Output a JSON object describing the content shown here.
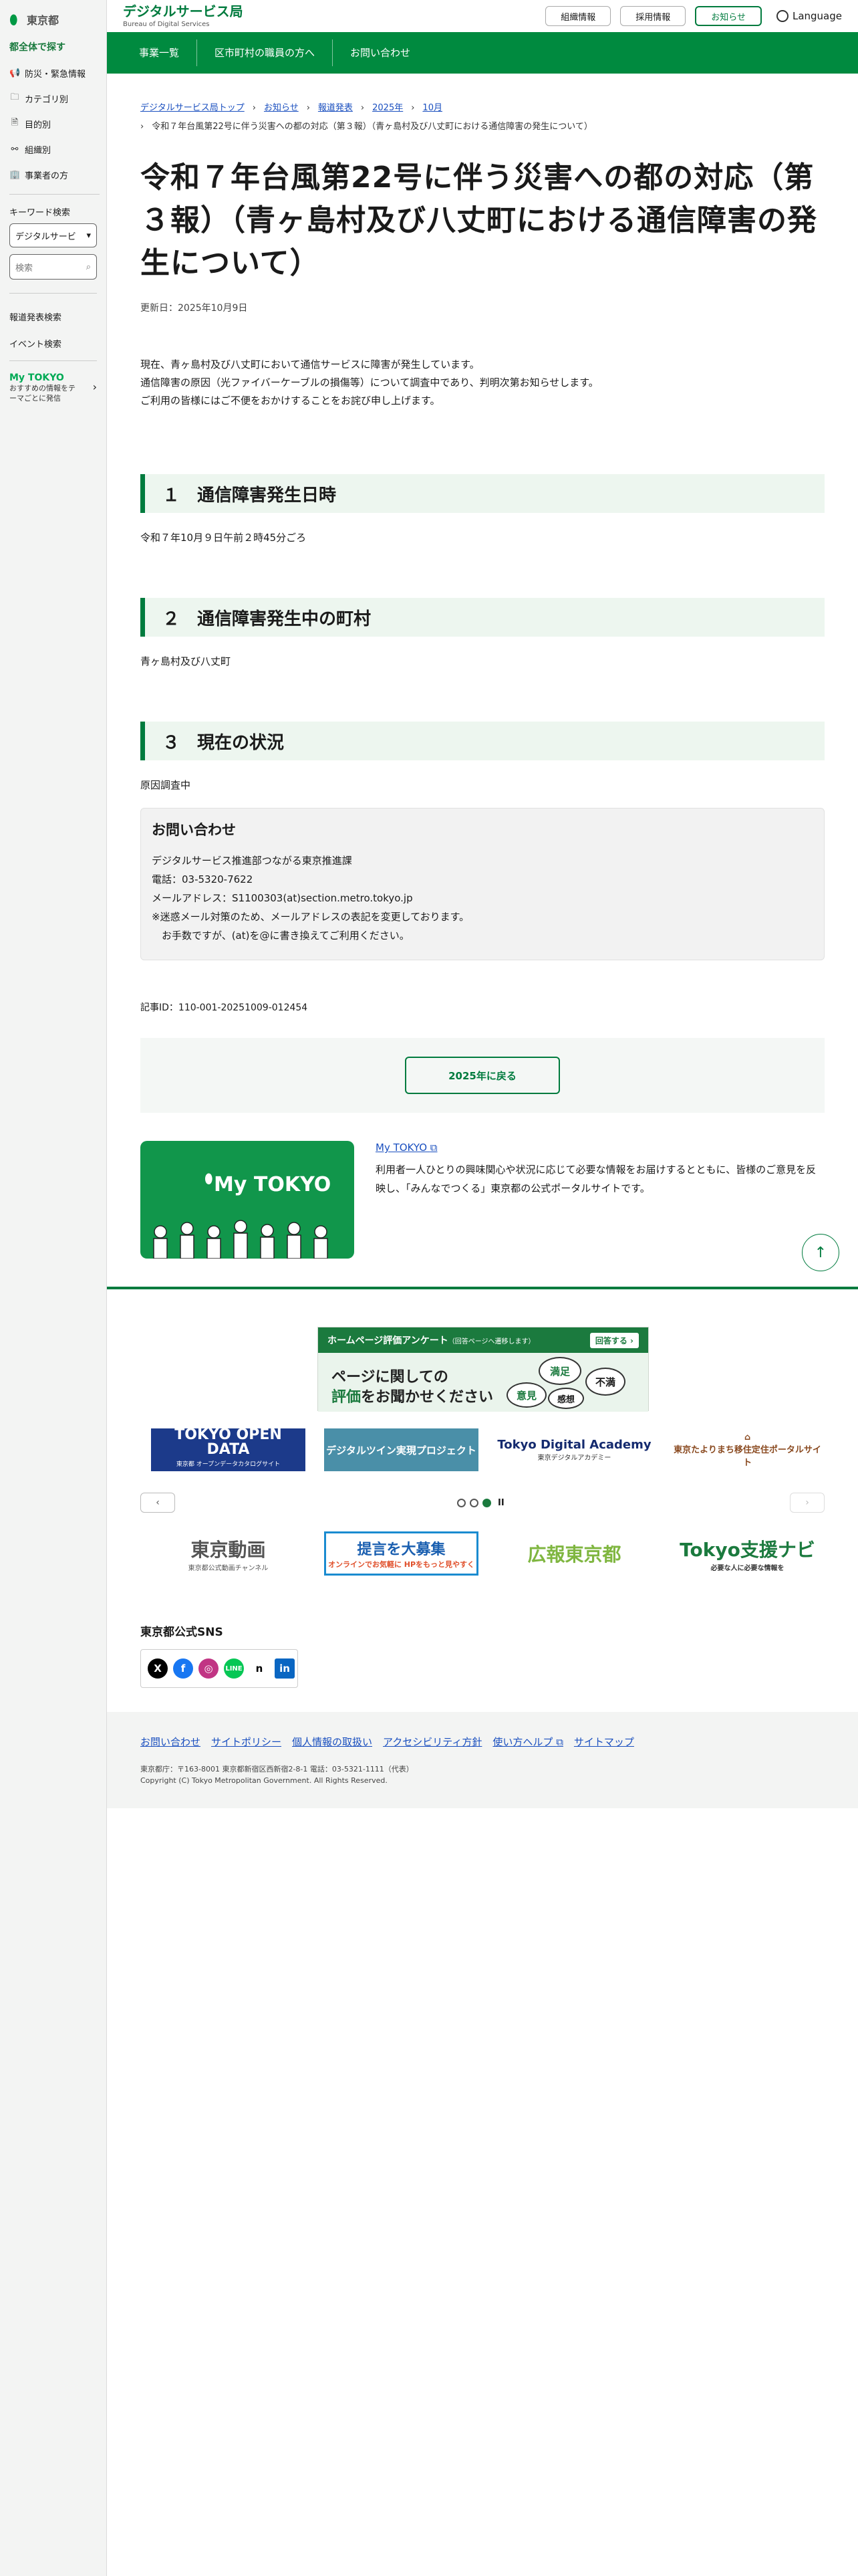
{
  "sidebar": {
    "logo_text": "東京都",
    "heading": "都全体で探す",
    "items": [
      {
        "icon": "megaphone-icon",
        "glyph": "📢",
        "label": "防災・緊急情報"
      },
      {
        "icon": "folder-icon",
        "glyph": "🗀",
        "label": "カテゴリ別"
      },
      {
        "icon": "document-icon",
        "glyph": "🗎",
        "label": "目的別"
      },
      {
        "icon": "org-icon",
        "glyph": "⚯",
        "label": "組織別"
      },
      {
        "icon": "building-icon",
        "glyph": "🏢",
        "label": "事業者の方"
      }
    ],
    "keyword_label": "キーワード検索",
    "keyword_select": "デジタルサービ",
    "search_placeholder": "検索",
    "links": [
      "報道発表検索",
      "イベント検索"
    ],
    "mytokyo_title": "My TOKYO",
    "mytokyo_desc": "おすすめの情報をテーマごとに発信"
  },
  "header": {
    "dept_name": "デジタルサービス局",
    "dept_en": "Bureau of Digital Services",
    "buttons": [
      "組織情報",
      "採用情報",
      "お知らせ"
    ],
    "language": "Language"
  },
  "nav": [
    "事業一覧",
    "区市町村の職員の方へ",
    "お問い合わせ"
  ],
  "breadcrumb": {
    "items": [
      "デジタルサービス局トップ",
      "お知らせ",
      "報道発表",
      "2025年",
      "10月"
    ],
    "current": "令和７年台風第22号に伴う災害への都の対応（第３報）（青ヶ島村及び八丈町における通信障害の発生について）"
  },
  "article": {
    "title": "令和７年台風第22号に伴う災害への都の対応（第３報）（青ヶ島村及び八丈町における通信障害の発生について）",
    "updated": "更新日：2025年10月9日",
    "lead": [
      "現在、青ヶ島村及び八丈町において通信サービスに障害が発生しています。",
      "通信障害の原因（光ファイバーケーブルの損傷等）について調査中であり、判明次第お知らせします。",
      "ご利用の皆様にはご不便をおかけすることをお詫び申し上げます。"
    ],
    "sections": [
      {
        "heading": "１　通信障害発生日時",
        "body": "令和７年10月９日午前２時45分ごろ"
      },
      {
        "heading": "２　通信障害発生中の町村",
        "body": "青ヶ島村及び八丈町"
      },
      {
        "heading": "３　現在の状況",
        "body": "原因調査中"
      }
    ],
    "contact": {
      "title": "お問い合わせ",
      "lines": [
        "デジタルサービス推進部つながる東京推進課",
        "電話：03-5320-7622",
        "メールアドレス：S1100303(at)section.metro.tokyo.jp",
        "※迷惑メール対策のため、メールアドレスの表記を変更しております。",
        "　お手数ですが、(at)を@に書き換えてご利用ください。"
      ]
    },
    "article_id": "記事ID：110-001-20251009-012454",
    "back_label": "2025年に戻る"
  },
  "promo": {
    "image_text": "My TOKYO",
    "link": "My TOKYO",
    "desc": "利用者一人ひとりの興味関心や状況に応じて必要な情報をお届けするとともに、皆様のご意見を反映し、「みんなでつくる」東京都の公式ポータルサイトです。"
  },
  "survey": {
    "bar_title": "ホームページ評価アンケート",
    "bar_note": "（回答ページへ遷移します）",
    "answer": "回答する ›",
    "line1": "ページに関しての",
    "line2_em": "評価",
    "line2_rest": "をお聞かせください",
    "bubbles": [
      "満足",
      "不満",
      "意見",
      "感想"
    ]
  },
  "banners": [
    {
      "title": "TOKYO OPEN DATA",
      "sub": "東京都 オープンデータカタログサイト"
    },
    {
      "title": "デジタルツイン実現プロジェクト",
      "sub": ""
    },
    {
      "title": "Tokyo Digital Academy",
      "sub": "東京デジタルアカデミー"
    },
    {
      "title": "東京たよりまち",
      "sub": "東京たよりまち移住定住ポータルサイト"
    }
  ],
  "carousel": {
    "prev": "‹",
    "next": "›",
    "pause": "II"
  },
  "banners2": [
    {
      "title": "東京動画",
      "sub": "東京都公式動画チャンネル"
    },
    {
      "title": "提言を大募集",
      "sub": "オンラインでお気軽に HPをもっと見やすく"
    },
    {
      "title": "広報東京都",
      "sub": ""
    },
    {
      "title": "Tokyo支援ナビ",
      "sub": "必要な人に必要な情報を"
    }
  ],
  "sns": {
    "title": "東京都公式SNS",
    "items": [
      "X",
      "f",
      "◎",
      "LINE",
      "n",
      "in"
    ]
  },
  "footer": {
    "links": [
      "お問い合わせ",
      "サイトポリシー",
      "個人情報の取扱い",
      "アクセシビリティ方針",
      "使い方ヘルプ",
      "サイトマップ"
    ],
    "address": "東京都庁：〒163-8001 東京都新宿区西新宿2-8-1 電話：03-5321-1111（代表）",
    "copyright": "Copyright (C) Tokyo Metropolitan Government. All Rights Reserved."
  }
}
